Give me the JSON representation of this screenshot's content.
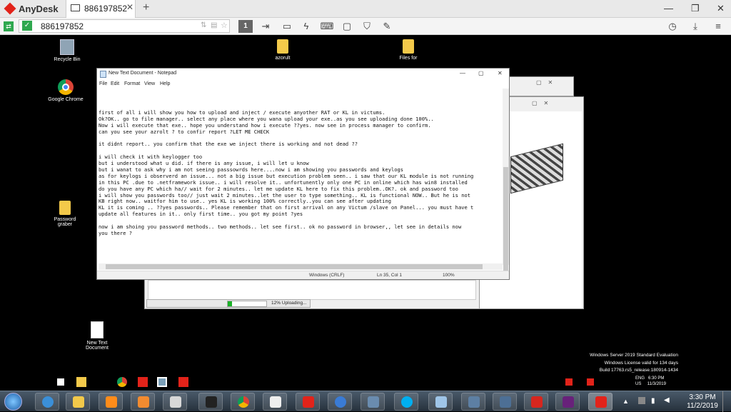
{
  "anydesk": {
    "brand": "AnyDesk",
    "tab_label": "886197852",
    "tab_close": "✕",
    "tab_add": "+",
    "address": "886197852",
    "brand_color": "#e2231a"
  },
  "desktop": {
    "icons": [
      {
        "label": "Recycle Bin"
      },
      {
        "label": "azorult"
      },
      {
        "label": "Files for"
      },
      {
        "label": "Google Chrome"
      },
      {
        "label": "Password graber"
      },
      {
        "label": "New Text Document"
      }
    ]
  },
  "notepad": {
    "title": "New Text Document - Notepad",
    "menu": [
      "File",
      "Edit",
      "Format",
      "View",
      "Help"
    ],
    "lines": [
      "first of all i will show you how to upload and inject / execute anyother RAT or KL in victums.",
      "Ok?OK.. go to file manager.. select any place where you wana upload your exe..as you see uploading done 100%..",
      "Now i will execute that exe.. hope you understand how i execute ??yes. now see in process manager to confirm.",
      "can you see your azrolt ? to confir report ?LET ME CHECK",
      "",
      "it didnt report.. you confirm that the exe we inject there is working and not dead ??",
      "",
      "i will check it with keylogger too",
      "but i understood what u did. if there is any issue, i will let u know",
      "but i wanat to ask why i am not seeing passsowrds here....now i am showing you passwords and keylogs",
      "as for keylogs i observerd an issue... not a big issue but execution problem seen.. i saw that our KL module is not running",
      "in this PC .due to .netframework issue.. i will resolve it.. unfortunently only one PC in online which has win8 installed",
      "do you have any PC which ha// wait for 2 minutes.. let me update KL here to fix this problem..OK?. ok and password too",
      "i will show you passwords too// just wait 2 minutes..let the user to type something.. KL is functional NOW.. But he is not",
      "KB right now.. waitfor him to use.. yes KL is working 100% correctly..you can see after updating",
      "KL it is coming .. ??yes passwords.. Please remember that on first arrival on any Victum /slave on Panel... you must have t",
      "update all features in it.. only first time.. you got my point ?yes",
      "",
      "now i am shoing you password methods.. two methods.. let see first.. ok no password in browser,, let see in details now",
      "you there ?"
    ],
    "status_encoding": "Windows (CRLF)",
    "status_position": "Ln 35, Col 1",
    "status_zoom": "100%"
  },
  "uploader": {
    "status": "12% Uploading...",
    "progress": 0.12,
    "progress_color": "#1bb127"
  },
  "watermark": {
    "line1": "Windows Server 2019 Standard Evaluation",
    "line2": "Windows License valid for 134 days",
    "line3": "Build 17763.rs5_release.180914-1434"
  },
  "remote_clock": {
    "lang": "ENG",
    "region": "US",
    "time": "6:30 PM",
    "date": "11/3/2019"
  },
  "local_clock": {
    "time": "3:30 PM",
    "date": "11/2/2019"
  }
}
